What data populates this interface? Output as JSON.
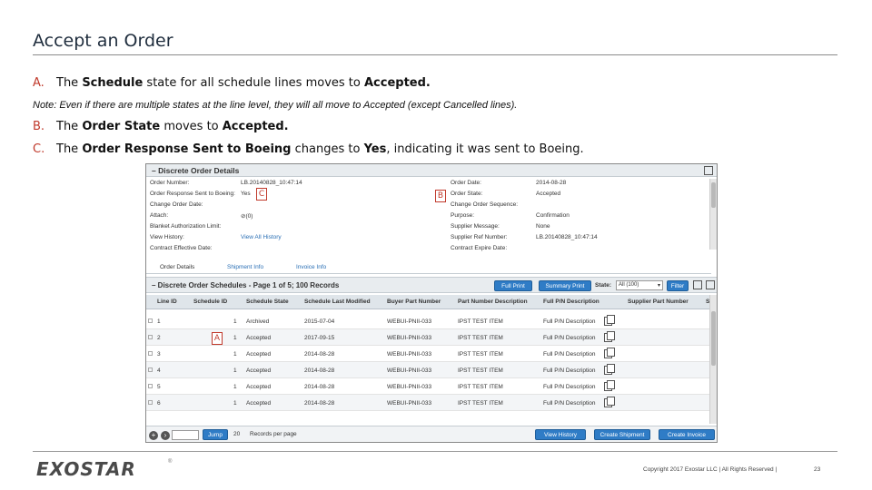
{
  "slide": {
    "title": "Accept an Order",
    "points": [
      {
        "marker": "A.",
        "parts": [
          "The ",
          "Schedule",
          " state for all schedule lines moves to ",
          "Accepted."
        ]
      },
      {
        "marker": "B.",
        "parts": [
          "The ",
          "Order State",
          " moves to ",
          "Accepted."
        ]
      },
      {
        "marker": "C.",
        "parts": [
          "The ",
          "Order Response Sent to Boeing",
          " changes to ",
          "Yes",
          ", indicating it was sent to Boeing."
        ]
      }
    ],
    "note": "Note:  Even if there are multiple states at the line level, they will all move to Accepted (except Cancelled lines)."
  },
  "details": {
    "header": "– Discrete Order Details",
    "left": [
      {
        "label": "Order Number:",
        "value": "LB.20140828_10:47:14",
        "link": false
      },
      {
        "label": "Order Response Sent to Boeing:",
        "value": "Yes",
        "link": false
      },
      {
        "label": "Change Order Date:",
        "value": "",
        "link": false
      },
      {
        "label": "Attach:",
        "value": "⊘(0)",
        "link": false
      },
      {
        "label": "Blanket Authorization Limit:",
        "value": "",
        "link": false
      },
      {
        "label": "View History:",
        "value": "View All History",
        "link": true
      },
      {
        "label": "Contract Effective Date:",
        "value": "",
        "link": false
      }
    ],
    "right": [
      {
        "label": "Order Date:",
        "value": "2014-08-28"
      },
      {
        "label": "Order State:",
        "value": "Accepted"
      },
      {
        "label": "Change Order Sequence:",
        "value": ""
      },
      {
        "label": "Purpose:",
        "value": "Confirmation"
      },
      {
        "label": "Supplier Message:",
        "value": "None"
      },
      {
        "label": "Supplier Ref Number:",
        "value": "LB.20140828_10:47:14"
      },
      {
        "label": "Contract Expire Date:",
        "value": ""
      }
    ]
  },
  "tabs": [
    "Order Details",
    "Shipment Info",
    "Invoice Info"
  ],
  "schedules": {
    "title": "– Discrete Order Schedules - Page 1 of 5; 100 Records",
    "buttons": {
      "full_print": "Full Print",
      "summary_print": "Summary Print",
      "filter": "Filter"
    },
    "state_label": "State:",
    "state_value": "All (100)",
    "columns": [
      "Line ID",
      "Schedule ID",
      "Schedule State",
      "Schedule Last Modified",
      "Buyer Part Number",
      "Part Number Description",
      "Full P/N Description",
      "Supplier Part Number",
      "S"
    ],
    "rows": [
      {
        "line": "1",
        "sched": "1",
        "state": "Archived",
        "modified": "2015-07-04",
        "buyer_pn": "WEBUI-PNII-033",
        "desc": "IPST TEST ITEM",
        "full": "Full P/N Description"
      },
      {
        "line": "2",
        "sched": "1",
        "state": "Accepted",
        "modified": "2017-09-15",
        "buyer_pn": "WEBUI-PNII-033",
        "desc": "IPST TEST ITEM",
        "full": "Full P/N Description"
      },
      {
        "line": "3",
        "sched": "1",
        "state": "Accepted",
        "modified": "2014-08-28",
        "buyer_pn": "WEBUI-PNII-033",
        "desc": "IPST TEST ITEM",
        "full": "Full P/N Description"
      },
      {
        "line": "4",
        "sched": "1",
        "state": "Accepted",
        "modified": "2014-08-28",
        "buyer_pn": "WEBUI-PNII-033",
        "desc": "IPST TEST ITEM",
        "full": "Full P/N Description"
      },
      {
        "line": "5",
        "sched": "1",
        "state": "Accepted",
        "modified": "2014-08-28",
        "buyer_pn": "WEBUI-PNII-033",
        "desc": "IPST TEST ITEM",
        "full": "Full P/N Description"
      },
      {
        "line": "6",
        "sched": "1",
        "state": "Accepted",
        "modified": "2014-08-28",
        "buyer_pn": "WEBUI-PNII-033",
        "desc": "IPST TEST ITEM",
        "full": "Full P/N Description"
      }
    ]
  },
  "pager": {
    "jump": "Jump",
    "per_page_value": "20",
    "per_page_label": "Records per page",
    "view_history": "View History",
    "create_shipment": "Create Shipment",
    "create_invoice": "Create Invoice"
  },
  "callouts": {
    "a": "A",
    "b": "B",
    "c": "C"
  },
  "footer": {
    "logo": "EXOSTAR",
    "logo_mark": "®",
    "copyright": "Copyright 2017 Exostar LLC | All Rights Reserved |",
    "page": "23"
  }
}
